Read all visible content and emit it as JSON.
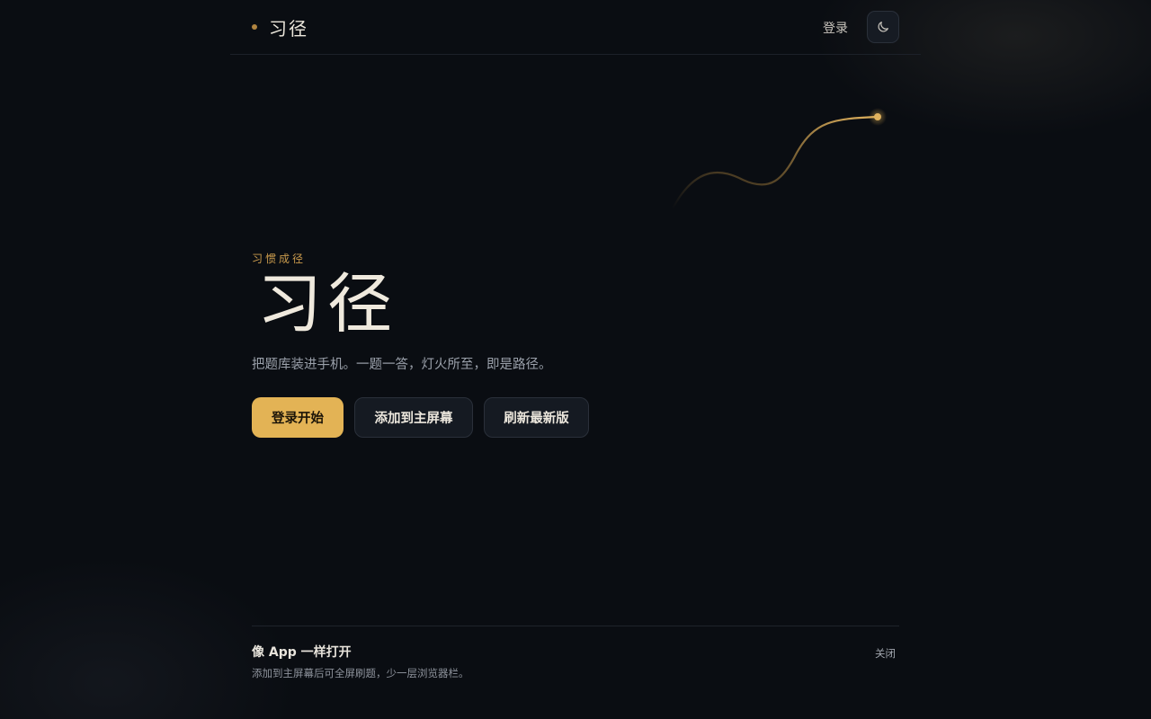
{
  "header": {
    "brand_name": "习径",
    "login_label": "登录",
    "theme_icon": "moon-icon"
  },
  "hero": {
    "eyebrow": "习惯成径",
    "title": "习径",
    "subtitle": "把题库装进手机。一题一答，灯火所至，即是路径。"
  },
  "actions": {
    "primary_label": "登录开始",
    "add_home_label": "添加到主屏幕",
    "refresh_label": "刷新最新版"
  },
  "install_banner": {
    "title": "像 App 一样打开",
    "description": "添加到主屏幕后可全屏刷题，少一层浏览器栏。",
    "close_label": "关闭"
  },
  "colors": {
    "background": "#0a0d12",
    "accent": "#e3b355",
    "accent_text": "#c99a4c",
    "surface": "#151a22"
  }
}
